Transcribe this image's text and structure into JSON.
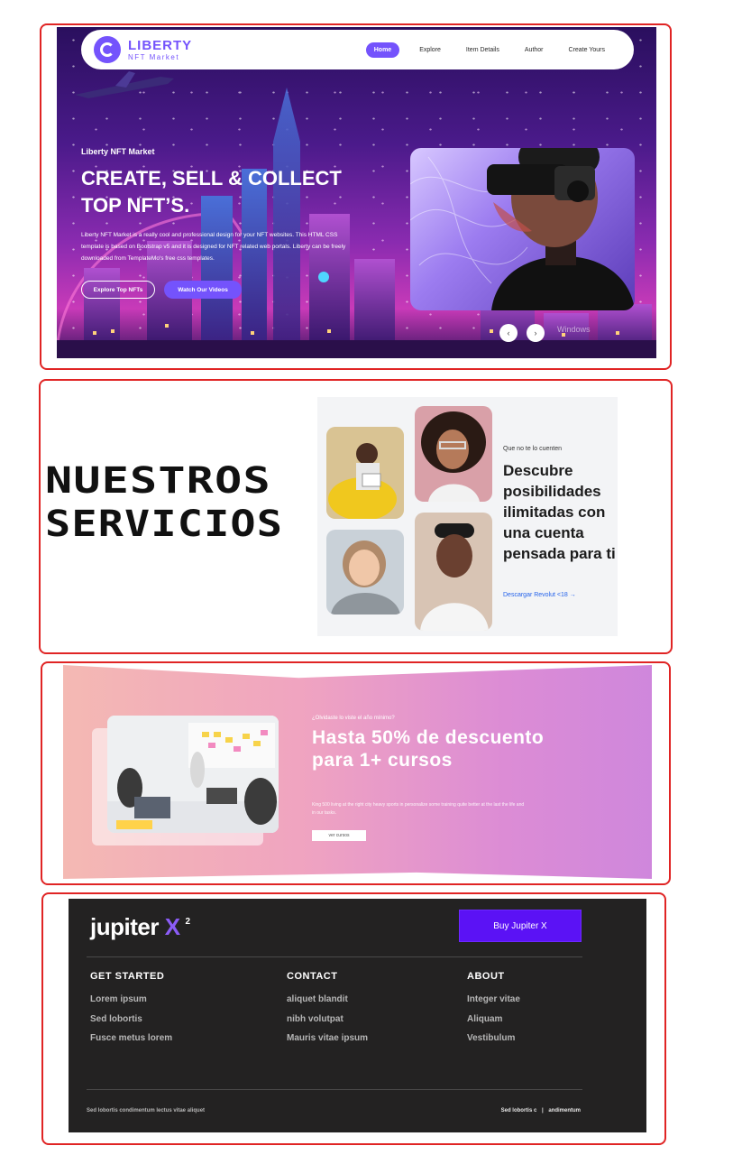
{
  "hero": {
    "logo_name": "LIBERTY",
    "logo_sub": "NFT Market",
    "nav": [
      "Home",
      "Explore",
      "Item Details",
      "Author",
      "Create Yours"
    ],
    "label": "Liberty NFT Market",
    "title_line1": "CREATE, SELL & COLLECT",
    "title_line2": "TOP NFT’S.",
    "description": "Liberty NFT Market is a really cool and professional design for your NFT websites. This HTML CSS template is based on Bootstrap v5 and it is designed for NFT related web portals. Liberty can be freely downloaded from TemplateMo's free css templates.",
    "btn_primary": "Explore Top NFTs",
    "btn_secondary": "Watch Our Videos",
    "prev_icon": "‹",
    "next_icon": "›",
    "watermark": "Windows"
  },
  "services": {
    "word1": "NUESTROS",
    "word2": "SERVICIOS",
    "eyebrow": "Que no te lo cuenten",
    "heading": "Descubre posibilidades ilimitadas con una cuenta pensada para ti",
    "link": "Descargar Revolut <18 →"
  },
  "promo": {
    "eyebrow": "¿Olvidaste lo viste el año mínimo?",
    "title": "Hasta 50% de descuento para 1+ cursos",
    "small": "King 500 living at the right city heavy sports in personalize some training quite better at the last the life and in our tasks.",
    "button": "ver cursos"
  },
  "footer": {
    "logo": "jupiter",
    "logo_x": "X",
    "logo_sup": "2",
    "buy": "Buy Jupiter X",
    "columns": [
      {
        "title": "GET STARTED",
        "items": [
          "Lorem ipsum",
          "Sed lobortis",
          "Fusce metus lorem"
        ]
      },
      {
        "title": "CONTACT",
        "items": [
          "aliquet blandit",
          "nibh volutpat",
          "Mauris vitae ipsum"
        ]
      },
      {
        "title": "ABOUT",
        "items": [
          "Integer vitae",
          "Aliquam",
          "Vestibulum"
        ]
      }
    ],
    "bottom_left": "Sed lobortis condimentum lectus vitae aliquet",
    "bottom_right_a": "Sed lobortis c",
    "bottom_sep": "|",
    "bottom_right_b": "andimentum"
  },
  "colors": {
    "accent": "#7453fc",
    "frame": "#e02424",
    "footer_bg": "#232222",
    "buy_btn": "#5b12f5",
    "link": "#2563eb"
  }
}
